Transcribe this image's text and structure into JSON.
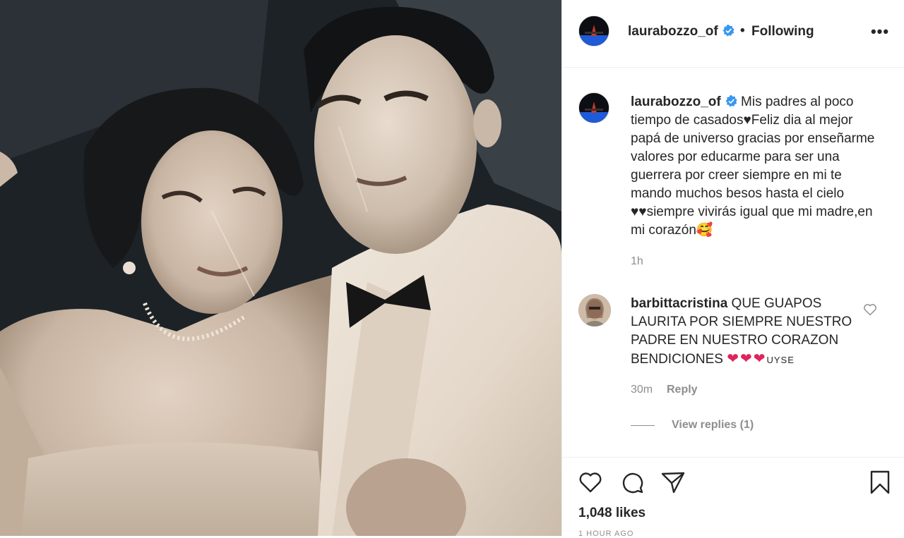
{
  "post": {
    "username": "laurabozzo_of",
    "separator": "•",
    "follow_state": "Following",
    "more_label": "•••"
  },
  "caption": {
    "username": "laurabozzo_of",
    "text": "Mis padres al poco tiempo de casados♥Feliz dia al mejor papá de universo gracias por enseñarme valores por educarme para ser una guerrera por creer siempre en mi te mando muchos besos hasta el cielo ♥♥siempre vivirás igual que mi madre,en mi corazón🥰",
    "time": "1h"
  },
  "comment": {
    "username": "barbittacristina",
    "text": "QUE GUAPOS LAURITA POR SIEMPRE NUESTRO PADRE EN NUESTRO CORAZON BENDICIONES",
    "hearts": "❤❤❤",
    "suffix": "UYSE",
    "time": "30m",
    "reply_label": "Reply",
    "view_replies": "View replies (1)"
  },
  "actions": {
    "likes": "1,048 likes",
    "time_ago": "1 HOUR AGO"
  },
  "icons": {
    "verified": "verified-badge-icon",
    "like": "heart-icon",
    "comment": "comment-bubble-icon",
    "share": "paper-plane-icon",
    "save": "bookmark-icon",
    "comment_like": "small-heart-icon"
  },
  "colors": {
    "verified_blue": "#3897f0",
    "text": "#262626",
    "muted": "#8e8e8e",
    "divider": "#efefef",
    "heart_red": "#e0245e"
  }
}
